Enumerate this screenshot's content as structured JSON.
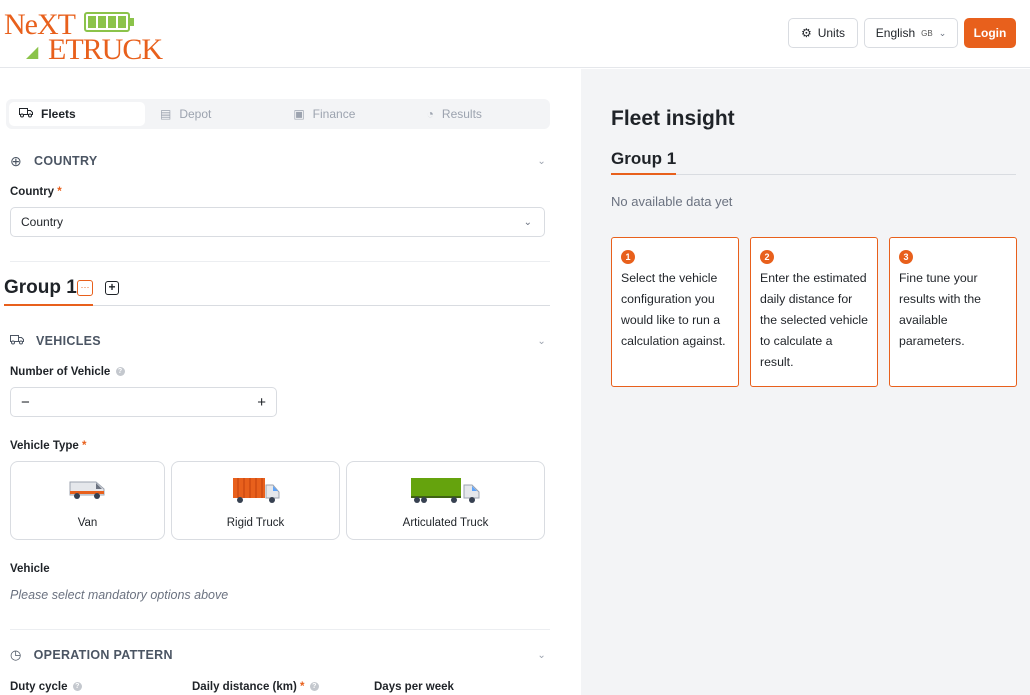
{
  "header": {
    "logo_text_1": "NeXT",
    "logo_text_2": "ETRUCK",
    "units_label": "Units",
    "language_label": "English",
    "language_region": "GB",
    "login_label": "Login"
  },
  "tabs": [
    {
      "label": "Fleets",
      "icon": "truck-icon",
      "active": true
    },
    {
      "label": "Depot",
      "icon": "depot-icon",
      "active": false
    },
    {
      "label": "Finance",
      "icon": "finance-icon",
      "active": false
    },
    {
      "label": "Results",
      "icon": "pie-chart-icon",
      "active": false
    }
  ],
  "country_section": {
    "heading": "COUNTRY",
    "field_label": "Country",
    "required_mark": "*",
    "select_value": "Country"
  },
  "group": {
    "title": "Group 1",
    "more_icon": "ellipsis-icon",
    "add_icon": "plus-square-icon"
  },
  "vehicles_section": {
    "heading": "VEHICLES",
    "number_label": "Number of Vehicle",
    "minus": "−",
    "plus": "+",
    "type_label": "Vehicle Type",
    "required_mark": "*",
    "types": [
      {
        "label": "Van"
      },
      {
        "label": "Rigid Truck"
      },
      {
        "label": "Articulated Truck"
      }
    ],
    "vehicle_label": "Vehicle",
    "vehicle_placeholder": "Please select mandatory options above"
  },
  "operation_section": {
    "heading": "OPERATION PATTERN",
    "duty_cycle_label": "Duty cycle",
    "daily_distance_label": "Daily distance (km)",
    "required_mark": "*",
    "days_per_week_label": "Days per week"
  },
  "insight": {
    "title": "Fleet insight",
    "group_title": "Group 1",
    "empty_text": "No available data yet",
    "steps": [
      {
        "num": "1",
        "text": "Select the vehicle configuration you would like to run a calculation against."
      },
      {
        "num": "2",
        "text": "Enter the estimated daily distance for the selected vehicle to calculate a result."
      },
      {
        "num": "3",
        "text": "Fine tune your results with the available parameters."
      }
    ]
  },
  "colors": {
    "accent": "#e8601c",
    "battery_green": "#8bc34a",
    "panel_bg": "#f3f4f6"
  }
}
